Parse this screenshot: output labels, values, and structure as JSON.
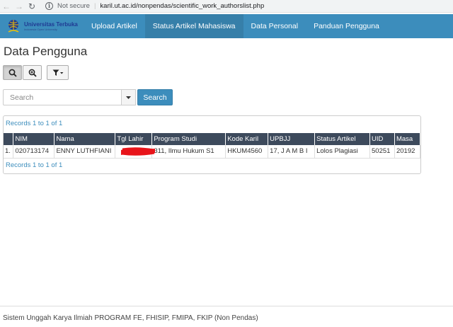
{
  "browser": {
    "security_label": "Not secure",
    "url": "karil.ut.ac.id/nonpendas/scientific_work_authorslist.php"
  },
  "navbar": {
    "brand_name": "Universitas Terbuka",
    "brand_sub": "Indonesia Open University",
    "links": [
      "Upload Artikel",
      "Status Artikel Mahasiswa",
      "Data Personal",
      "Panduan Pengguna"
    ],
    "active_index": 1,
    "brand_color": "#3c8dbc"
  },
  "page": {
    "title": "Data Pengguna"
  },
  "search": {
    "placeholder": "Search",
    "button_label": "Search"
  },
  "table": {
    "records_top": "Records 1 to 1 of 1",
    "records_bottom": "Records 1 to 1 of 1",
    "columns": [
      "NIM",
      "Nama",
      "Tgl Lahir",
      "Program Studi",
      "Kode Karil",
      "UPBJJ",
      "Status Artikel",
      "UID",
      "Masa"
    ],
    "rows": [
      {
        "index": "1.",
        "nim": "020713174",
        "nama": "ENNY LUTHFIANI",
        "tgl_lahir": "",
        "program_studi": "311, Ilmu Hukum S1",
        "kode_karil": "HKUM4560",
        "upbjj": "17, J A M B I",
        "status_artikel": "Lolos Plagiasi",
        "uid": "50251",
        "masa": "20192"
      }
    ]
  },
  "footer": {
    "text": "Sistem Unggah Karya Ilmiah PROGRAM FE, FHISIP, FMIPA, FKIP (Non Pendas)"
  }
}
